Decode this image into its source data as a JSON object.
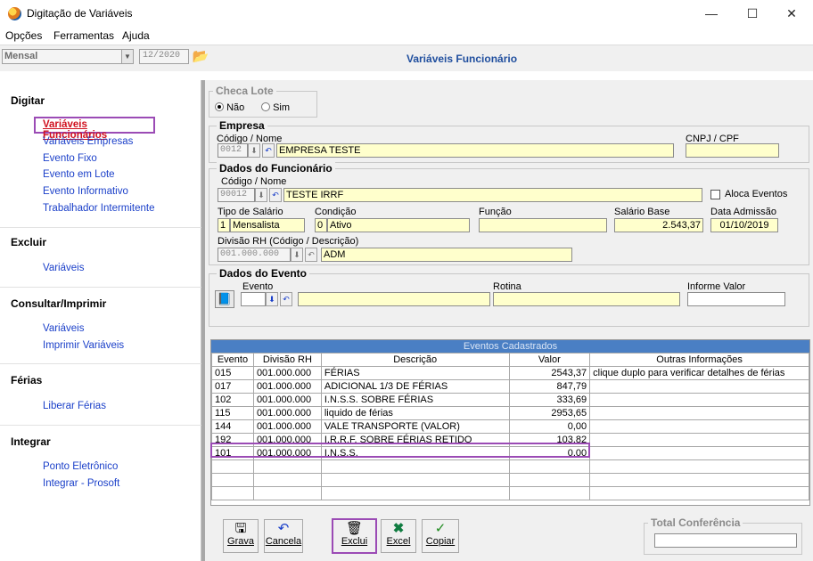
{
  "window": {
    "title": "Digitação de Variáveis",
    "minimize": "—",
    "maximize": "☐",
    "close": "✕"
  },
  "menu": [
    "Opções",
    "Ferramentas",
    "Ajuda"
  ],
  "toolbar": {
    "period_type": "Mensal",
    "competencia": "12/2020",
    "page_title": "Variáveis Funcionário"
  },
  "sidebar": {
    "digitar": {
      "title": "Digitar",
      "items": [
        "Variáveis Funcionários",
        "Variáveis Empresas",
        "Evento Fixo",
        "Evento em Lote",
        "Evento Informativo",
        "Trabalhador Intermitente"
      ]
    },
    "excluir": {
      "title": "Excluir",
      "items": [
        "Variáveis"
      ]
    },
    "consultar": {
      "title": "Consultar/Imprimir",
      "items": [
        "Variáveis",
        "Imprimir Variáveis"
      ]
    },
    "ferias": {
      "title": "Férias",
      "items": [
        "Liberar Férias"
      ]
    },
    "integrar": {
      "title": "Integrar",
      "items": [
        "Ponto Eletrônico",
        "Integrar - Prosoft"
      ]
    }
  },
  "checa_lote": {
    "title": "Checa Lote",
    "nao": "Não",
    "sim": "Sim",
    "selected": "Não"
  },
  "empresa": {
    "title": "Empresa",
    "codigo_label": "Código / Nome",
    "codigo": "0012",
    "nome": "EMPRESA TESTE",
    "cnpj_label": "CNPJ / CPF",
    "cnpj": ""
  },
  "funcionario": {
    "title": "Dados do Funcionário",
    "codigo_label": "Código / Nome",
    "codigo": "90012",
    "nome": "TESTE IRRF",
    "aloca_label": "Aloca Eventos",
    "tipo_label": "Tipo de Salário",
    "tipo_cod": "1",
    "tipo": "Mensalista",
    "condicao_label": "Condição",
    "condicao_cod": "0",
    "condicao": "Ativo",
    "funcao_label": "Função",
    "funcao": "",
    "salario_label": "Salário Base",
    "salario": "2.543,37",
    "admissao_label": "Data Admissão",
    "admissao": "01/10/2019",
    "divisao_label": "Divisão RH (Código / Descrição)",
    "divisao_cod": "001.000.000",
    "divisao": "ADM"
  },
  "evento": {
    "title": "Dados do Evento",
    "evento_label": "Evento",
    "rotina_label": "Rotina",
    "informe_label": "Informe Valor"
  },
  "grid": {
    "title": "Eventos Cadastrados",
    "columns": [
      "Evento",
      "Divisão RH",
      "Descrição",
      "Valor",
      "Outras Informações"
    ],
    "rows": [
      [
        "015",
        "001.000.000",
        "FÉRIAS",
        "2543,37",
        "clique duplo para verificar detalhes de férias"
      ],
      [
        "017",
        "001.000.000",
        "ADICIONAL 1/3 DE FÉRIAS",
        "847,79",
        ""
      ],
      [
        "102",
        "001.000.000",
        "I.N.S.S. SOBRE FÉRIAS",
        "333,69",
        ""
      ],
      [
        "115",
        "001.000.000",
        "liquido de férias",
        "2953,65",
        ""
      ],
      [
        "144",
        "001.000.000",
        "VALE TRANSPORTE (VALOR)",
        "0,00",
        ""
      ],
      [
        "192",
        "001.000.000",
        "I.R.R.F. SOBRE FÉRIAS RETIDO",
        "103,82",
        ""
      ],
      [
        "101",
        "001.000.000",
        "I.N.S.S.",
        "0,00",
        ""
      ]
    ]
  },
  "buttons": {
    "grava": "Grava",
    "cancela": "Cancela",
    "exclui": "Exclui",
    "excel": "Excel",
    "copiar": "Copiar"
  },
  "total": {
    "title": "Total Conferência",
    "value": ""
  },
  "colors": {
    "link": "#1a3fc9",
    "active_link": "#d0101e",
    "highlight": "#9b4bb5",
    "field_bg": "#ffffcc",
    "grid_header": "#4a7fc4"
  }
}
